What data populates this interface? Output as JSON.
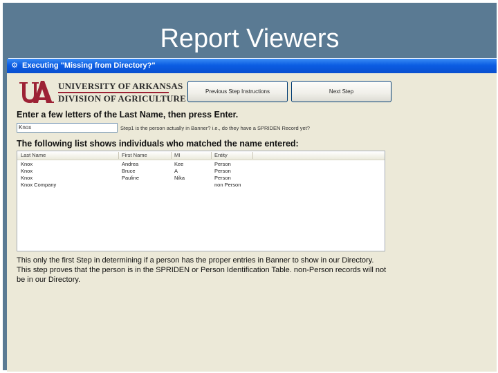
{
  "slide": {
    "title": "Report Viewers"
  },
  "window": {
    "title": "Executing \"Missing from Directory?\"",
    "title_icon": "window-app-icon"
  },
  "logo": {
    "mark_text": "UA",
    "line1": "UNIVERSITY OF ARKANSAS",
    "line2": "DIVISION OF AGRICULTURE",
    "brand_color": "#9d2235"
  },
  "buttons": {
    "previous": "Previous Step Instructions",
    "next": "Next Step"
  },
  "search": {
    "label": "Enter a few letters of the Last Name, then press Enter.",
    "value": "Knox",
    "step_note": "Step1 is the person actually in Banner? i.e., do they have a SPRIDEN Record yet?"
  },
  "results": {
    "label": "The following list shows individuals who matched the name entered:",
    "columns": [
      "Last Name",
      "First Name",
      "MI",
      "Entity"
    ],
    "rows": [
      [
        "Knox",
        "Andrea",
        "Kee",
        "Person"
      ],
      [
        "Knox",
        "Bruce",
        "A",
        "Person"
      ],
      [
        "Knox",
        "Pauline",
        "Nika",
        "Person"
      ],
      [
        "Knox Company",
        "",
        "",
        "non Person"
      ]
    ]
  },
  "explanation": "This only the first Step in determining if a person has the proper entries in Banner to show in our Directory.  This step proves that the person is in the SPRIDEN or Person Identification Table.  non-Person records will not be in our Directory."
}
